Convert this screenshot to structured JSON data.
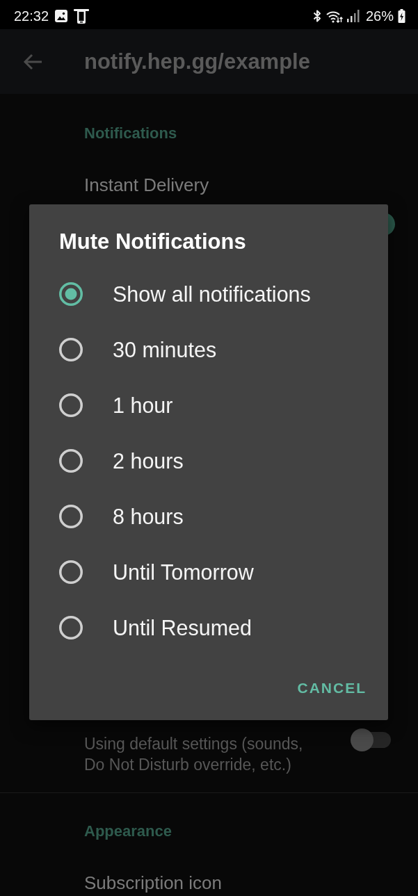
{
  "status_bar": {
    "time": "22:32",
    "battery": "26%"
  },
  "app_bar": {
    "title": "notify.hep.gg/example"
  },
  "sections": [
    {
      "header": "Notifications",
      "items": [
        {
          "kind": "switch",
          "title": "Instant Delivery",
          "on": true
        },
        {
          "kind": "switch",
          "summary": "Using default settings (sounds, Do Not Disturb override, etc.)",
          "on": false
        }
      ]
    },
    {
      "header": "Appearance",
      "items": [
        {
          "kind": "plain",
          "title": "Subscription icon"
        }
      ]
    }
  ],
  "dialog": {
    "title": "Mute Notifications",
    "options": [
      {
        "label": "Show all notifications",
        "selected": true
      },
      {
        "label": "30 minutes",
        "selected": false
      },
      {
        "label": "1 hour",
        "selected": false
      },
      {
        "label": "2 hours",
        "selected": false
      },
      {
        "label": "8 hours",
        "selected": false
      },
      {
        "label": "Until Tomorrow",
        "selected": false
      },
      {
        "label": "Until Resumed",
        "selected": false
      }
    ],
    "buttons": [
      "CANCEL"
    ]
  }
}
